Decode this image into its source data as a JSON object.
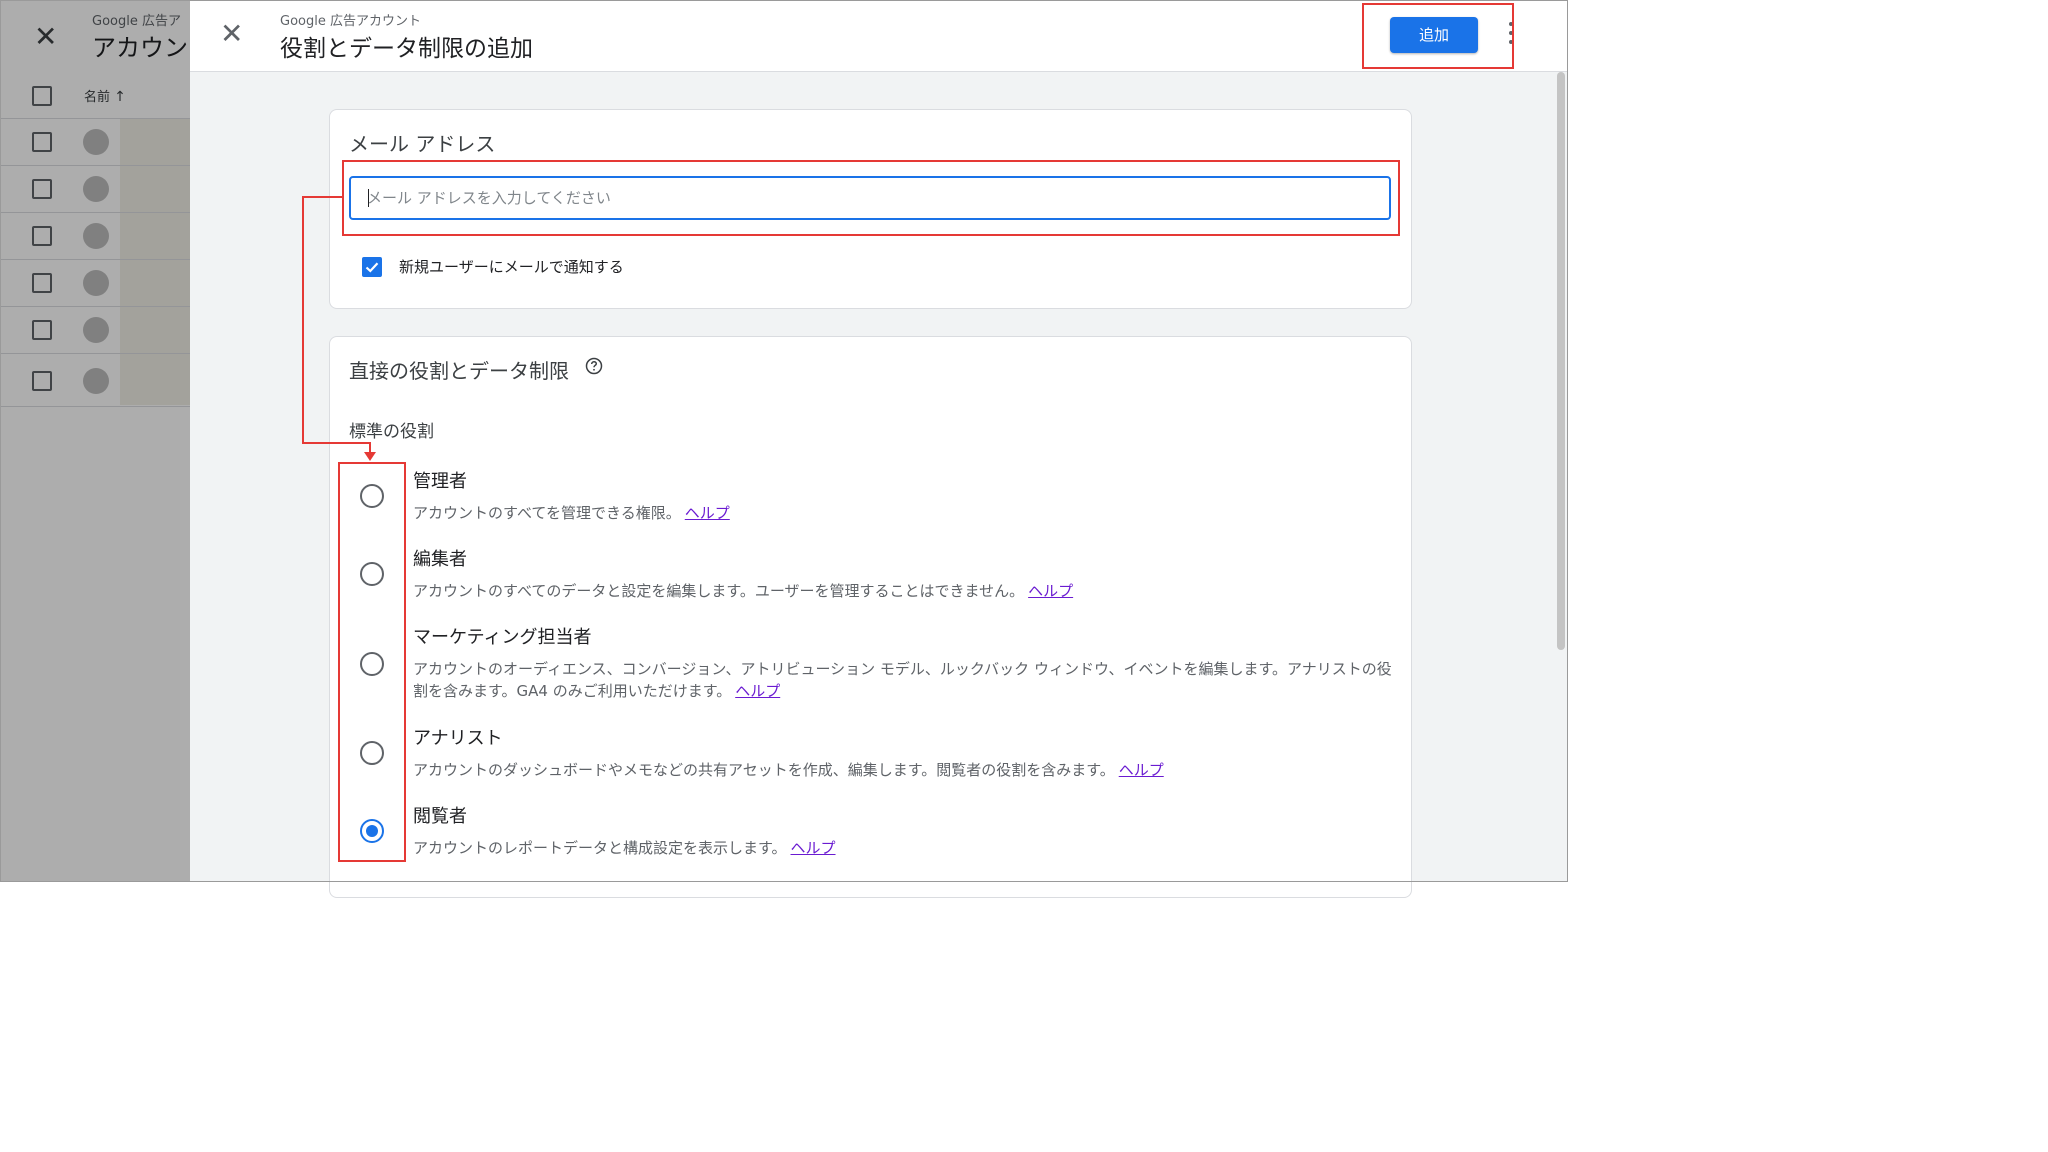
{
  "background_page": {
    "subtitle": "Google 広告ア",
    "title": "アカウン",
    "column_name": "名前"
  },
  "dialog": {
    "subtitle": "Google 広告アカウント",
    "title": "役割とデータ制限の追加",
    "add_button": "追加",
    "email_section": {
      "title": "メール アドレス",
      "placeholder": "メール アドレスを入力してください",
      "notify_label": "新規ユーザーにメールで通知する",
      "notify_checked": true
    },
    "roles_section": {
      "title": "直接の役割とデータ制限",
      "subtitle": "標準の役割",
      "help_link": "ヘルプ",
      "roles": [
        {
          "name": "管理者",
          "desc": "アカウントのすべてを管理できる権限。",
          "selected": false
        },
        {
          "name": "編集者",
          "desc": "アカウントのすべてのデータと設定を編集します。ユーザーを管理することはできません。",
          "selected": false
        },
        {
          "name": "マーケティング担当者",
          "desc": "アカウントのオーディエンス、コンバージョン、アトリビューション モデル、ルックバック ウィンドウ、イベントを編集します。アナリストの役割を含みます。GA4 のみご利用いただけます。",
          "selected": false
        },
        {
          "name": "アナリスト",
          "desc": "アカウントのダッシュボードやメモなどの共有アセットを作成、編集します。閲覧者の役割を含みます。",
          "selected": false
        },
        {
          "name": "閲覧者",
          "desc": "アカウントのレポートデータと構成設定を表示します。",
          "selected": true
        }
      ]
    }
  },
  "colors": {
    "accent": "#1a73e8",
    "annotation": "#e53935",
    "link": "#6a1bd1"
  }
}
